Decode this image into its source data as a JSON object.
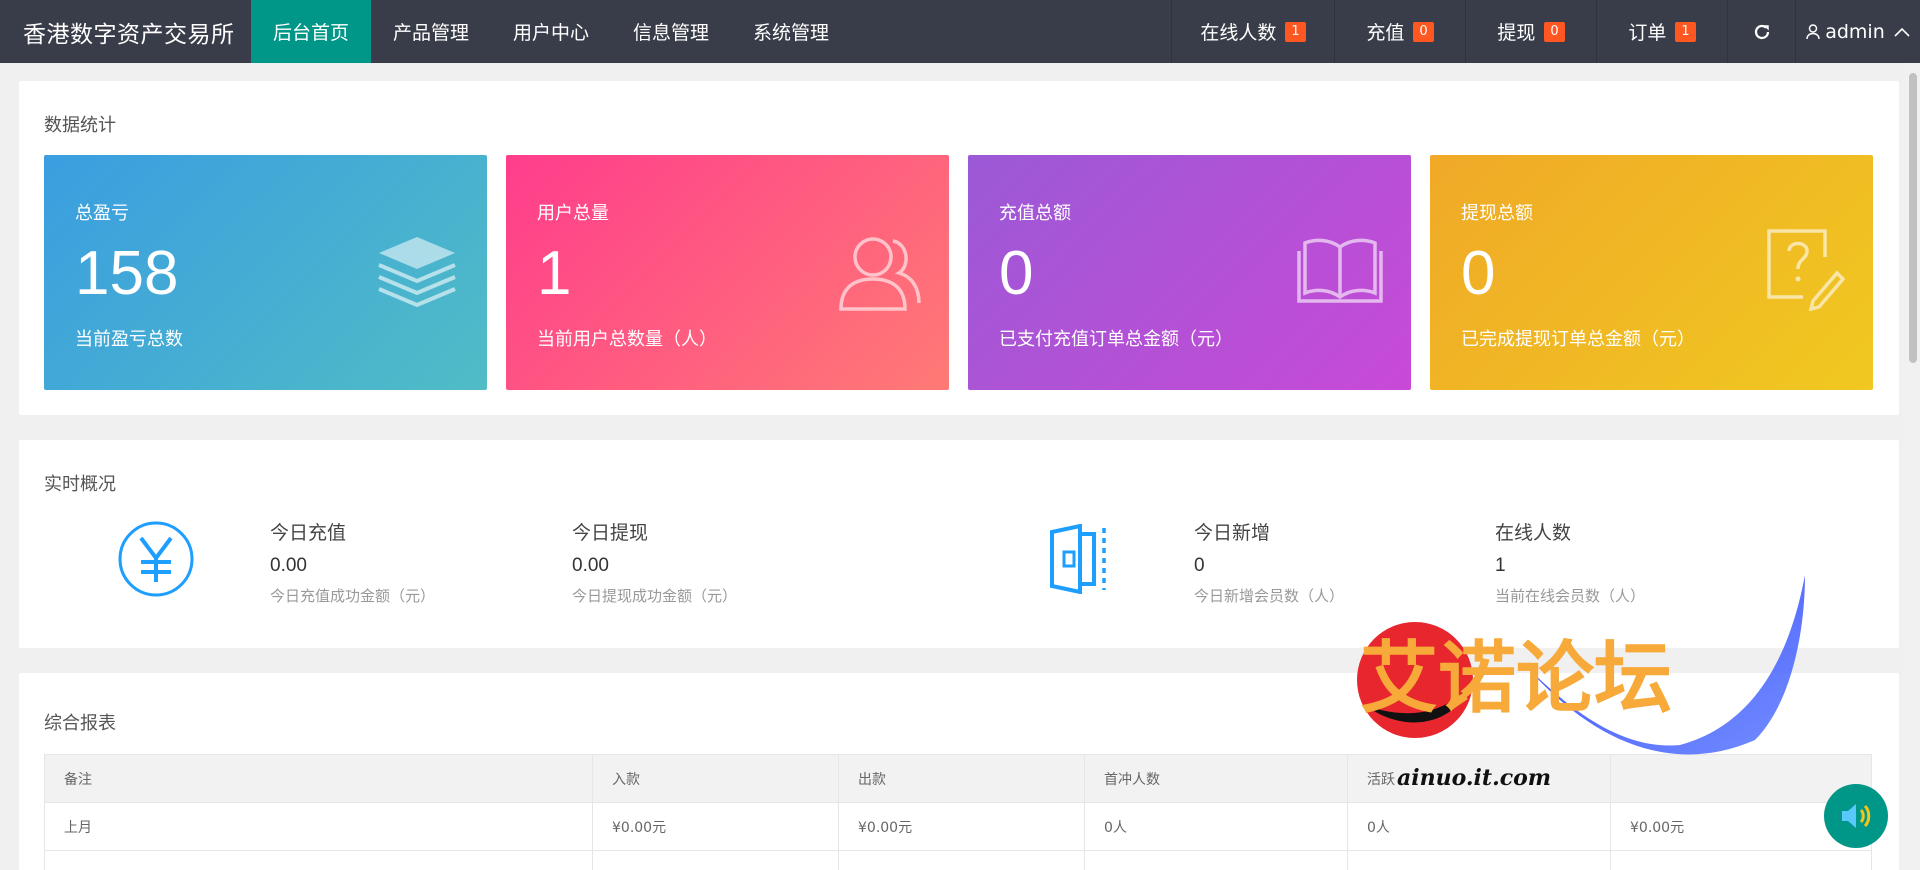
{
  "navbar": {
    "brand": "香港数字资产交易所",
    "items": [
      {
        "label": "后台首页",
        "active": true
      },
      {
        "label": "产品管理"
      },
      {
        "label": "用户中心"
      },
      {
        "label": "信息管理"
      },
      {
        "label": "系统管理"
      }
    ],
    "right": {
      "online_label": "在线人数",
      "online_count": "1",
      "recharge_label": "充值",
      "recharge_count": "0",
      "withdraw_label": "提现",
      "withdraw_count": "0",
      "order_label": "订单",
      "order_count": "1",
      "user": "admin"
    }
  },
  "stats": {
    "title": "数据统计",
    "cards": [
      {
        "label": "总盈亏",
        "value": "158",
        "desc": "当前盈亏总数",
        "icon": "layers-icon"
      },
      {
        "label": "用户总量",
        "value": "1",
        "desc": "当前用户总数量（人）",
        "icon": "users-icon"
      },
      {
        "label": "充值总额",
        "value": "0",
        "desc": "已支付充值订单总金额（元）",
        "icon": "book-icon"
      },
      {
        "label": "提现总额",
        "value": "0",
        "desc": "已完成提现订单总金额（元）",
        "icon": "help-edit-icon"
      }
    ]
  },
  "realtime": {
    "title": "实时概况",
    "items": [
      {
        "label": "今日充值",
        "value": "0.00",
        "sub": "今日充值成功金额（元）"
      },
      {
        "label": "今日提现",
        "value": "0.00",
        "sub": "今日提现成功金额（元）"
      },
      {
        "label": "今日新增",
        "value": "0",
        "sub": "今日新增会员数（人）"
      },
      {
        "label": "在线人数",
        "value": "1",
        "sub": "当前在线会员数（人）"
      }
    ]
  },
  "report": {
    "title": "综合报表",
    "columns": [
      "备注",
      "入款",
      "出款",
      "首冲人数",
      "活跃",
      ""
    ],
    "rows": [
      [
        "上月",
        "¥0.00元",
        "¥0.00元",
        "0人",
        "0人",
        "¥0.00元"
      ]
    ]
  },
  "watermark": {
    "text": "艾诺论坛",
    "url": "ainuo.it.com"
  },
  "colors": {
    "nav_bg": "#393d49",
    "accent": "#009688",
    "badge": "#ff5722"
  }
}
